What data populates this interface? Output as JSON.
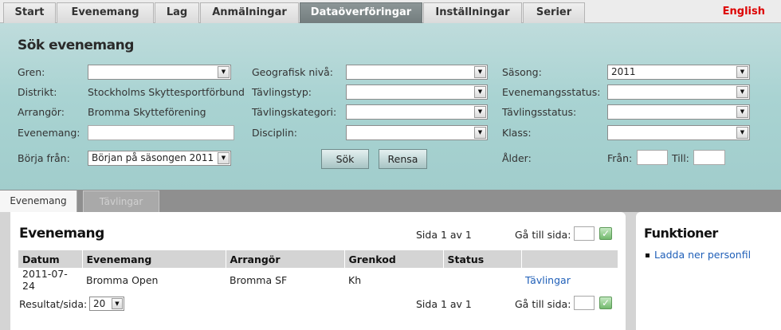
{
  "nav": {
    "tabs": [
      {
        "label": "Start"
      },
      {
        "label": "Evenemang"
      },
      {
        "label": "Lag"
      },
      {
        "label": "Anmälningar"
      },
      {
        "label": "Dataöverföringar"
      },
      {
        "label": "Inställningar"
      },
      {
        "label": "Serier"
      }
    ],
    "language": "English"
  },
  "search": {
    "title": "Sök evenemang",
    "gren": {
      "label": "Gren:",
      "value": ""
    },
    "distrikt": {
      "label": "Distrikt:",
      "value": "Stockholms Skyttesportförbund"
    },
    "arrangor": {
      "label": "Arrangör:",
      "value": "Bromma Skytteförening"
    },
    "evenemang": {
      "label": "Evenemang:",
      "value": ""
    },
    "borja": {
      "label": "Börja från:",
      "value": "Början på säsongen 2011"
    },
    "geografisk": {
      "label": "Geografisk nivå:",
      "value": ""
    },
    "tavlingstyp": {
      "label": "Tävlingstyp:",
      "value": ""
    },
    "tavlingskategori": {
      "label": "Tävlingskategori:",
      "value": ""
    },
    "disciplin": {
      "label": "Disciplin:",
      "value": ""
    },
    "sasong": {
      "label": "Säsong:",
      "value": "2011"
    },
    "evenemangsstatus": {
      "label": "Evenemangsstatus:",
      "value": ""
    },
    "tavlingsstatus": {
      "label": "Tävlingsstatus:",
      "value": ""
    },
    "klass": {
      "label": "Klass:",
      "value": ""
    },
    "alder": {
      "label": "Ålder:",
      "from_label": "Från:",
      "to_label": "Till:"
    },
    "search_button": "Sök",
    "clear_button": "Rensa"
  },
  "subtabs": {
    "evenemang": "Evenemang",
    "tavlingar": "Tävlingar"
  },
  "results": {
    "title": "Evenemang",
    "pager_top": "Sida 1 av 1",
    "goto_label": "Gå till sida:",
    "columns": [
      "Datum",
      "Evenemang",
      "Arrangör",
      "Grenkod",
      "Status",
      ""
    ],
    "rows": [
      {
        "datum": "2011-07-24",
        "evenemang": "Bromma Open",
        "arrangor": "Bromma SF",
        "grenkod": "Kh",
        "status": "",
        "link": "Tävlingar"
      }
    ],
    "per_page_label": "Resultat/sida:",
    "per_page_value": "20",
    "pager_bottom": "Sida 1 av 1"
  },
  "functions": {
    "title": "Funktioner",
    "items": [
      {
        "label": "Ladda ner personfil"
      }
    ]
  }
}
